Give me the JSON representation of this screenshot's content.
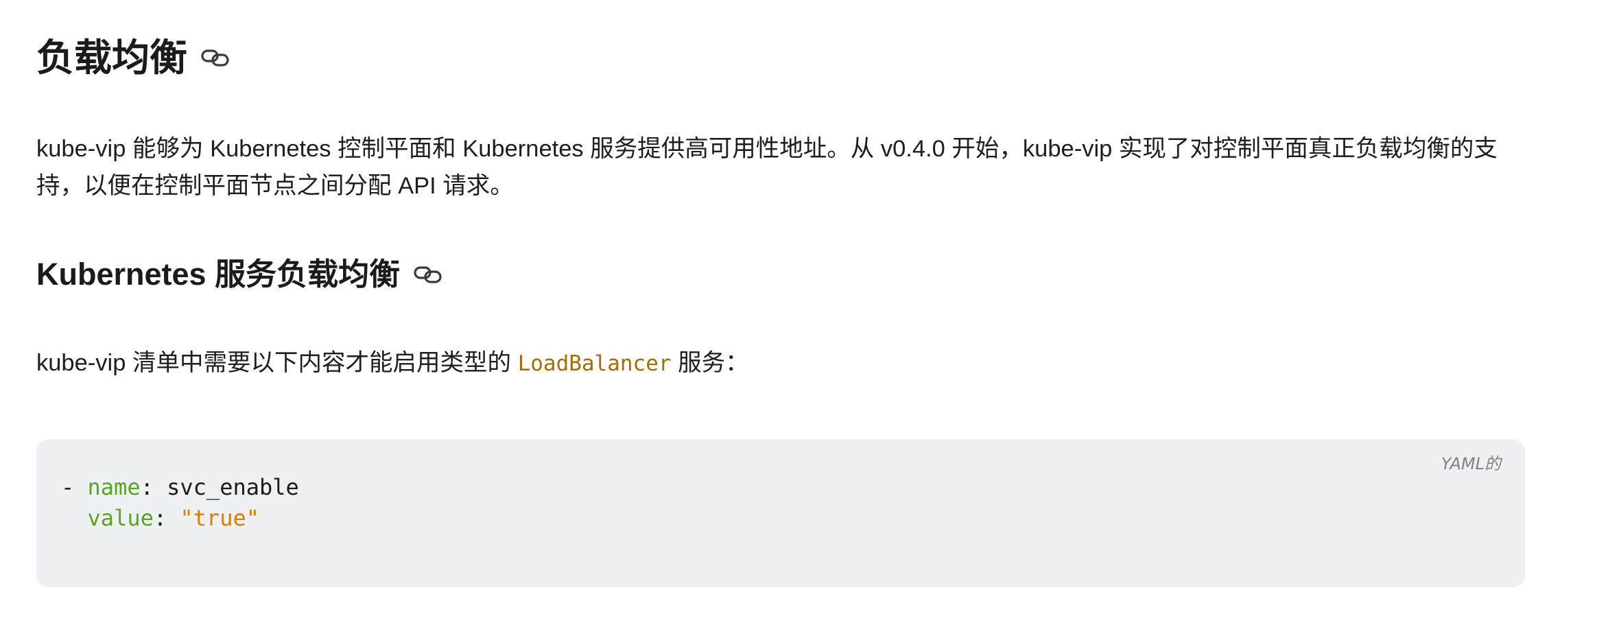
{
  "section_lb": {
    "title": "负载均衡",
    "anchor_icon": "link-icon",
    "intro": "kube-vip 能够为 Kubernetes 控制平面和 Kubernetes 服务提供高可用性地址。从 v0.4.0 开始，kube-vip 实现了对控制平面真正负载均衡的支持，以便在控制平面节点之间分配 API 请求。"
  },
  "section_svc": {
    "title": "Kubernetes 服务负载均衡",
    "anchor_icon": "link-icon",
    "text_before": "kube-vip 清单中需要以下内容才能启用类型的 ",
    "code_inline": "LoadBalancer",
    "text_after": " 服务："
  },
  "code_block": {
    "language_label": "YAML的",
    "line1": {
      "dash": "- ",
      "key": "name",
      "sep": ": ",
      "value": "svc_enable"
    },
    "line2": {
      "indent": "  ",
      "key": "value",
      "sep": ": ",
      "value": "\"true\""
    }
  },
  "colors": {
    "code_bg": "#eef1f4",
    "yaml_key": "#5aa51c",
    "yaml_string": "#e07b00",
    "inline_code": "#a86d00"
  }
}
